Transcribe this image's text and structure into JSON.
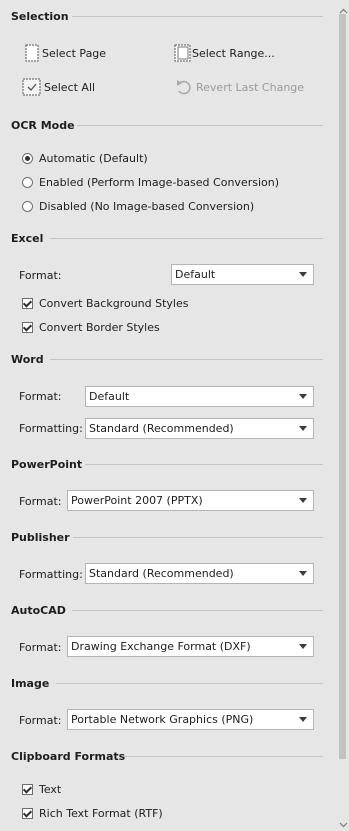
{
  "selection": {
    "title": "Selection",
    "select_page": "Select Page",
    "select_range": "Select Range...",
    "select_all": "Select All",
    "revert": "Revert Last Change"
  },
  "ocr": {
    "title": "OCR Mode",
    "options": [
      "Automatic (Default)",
      "Enabled (Perform Image-based Conversion)",
      "Disabled (No Image-based Conversion)"
    ],
    "selected": 0
  },
  "excel": {
    "title": "Excel",
    "format_label": "Format:",
    "format_value": "Default",
    "checks": [
      "Convert Background Styles",
      "Convert Border Styles"
    ]
  },
  "word": {
    "title": "Word",
    "format_label": "Format:",
    "format_value": "Default",
    "formatting_label": "Formatting:",
    "formatting_value": "Standard (Recommended)"
  },
  "powerpoint": {
    "title": "PowerPoint",
    "format_label": "Format:",
    "format_value": "PowerPoint 2007 (PPTX)"
  },
  "publisher": {
    "title": "Publisher",
    "formatting_label": "Formatting:",
    "formatting_value": "Standard (Recommended)"
  },
  "autocad": {
    "title": "AutoCAD",
    "format_label": "Format:",
    "format_value": "Drawing Exchange Format (DXF)"
  },
  "image": {
    "title": "Image",
    "format_label": "Format:",
    "format_value": "Portable Network Graphics (PNG)"
  },
  "clipboard": {
    "title": "Clipboard Formats",
    "checks": [
      "Text",
      "Rich Text Format (RTF)"
    ]
  }
}
